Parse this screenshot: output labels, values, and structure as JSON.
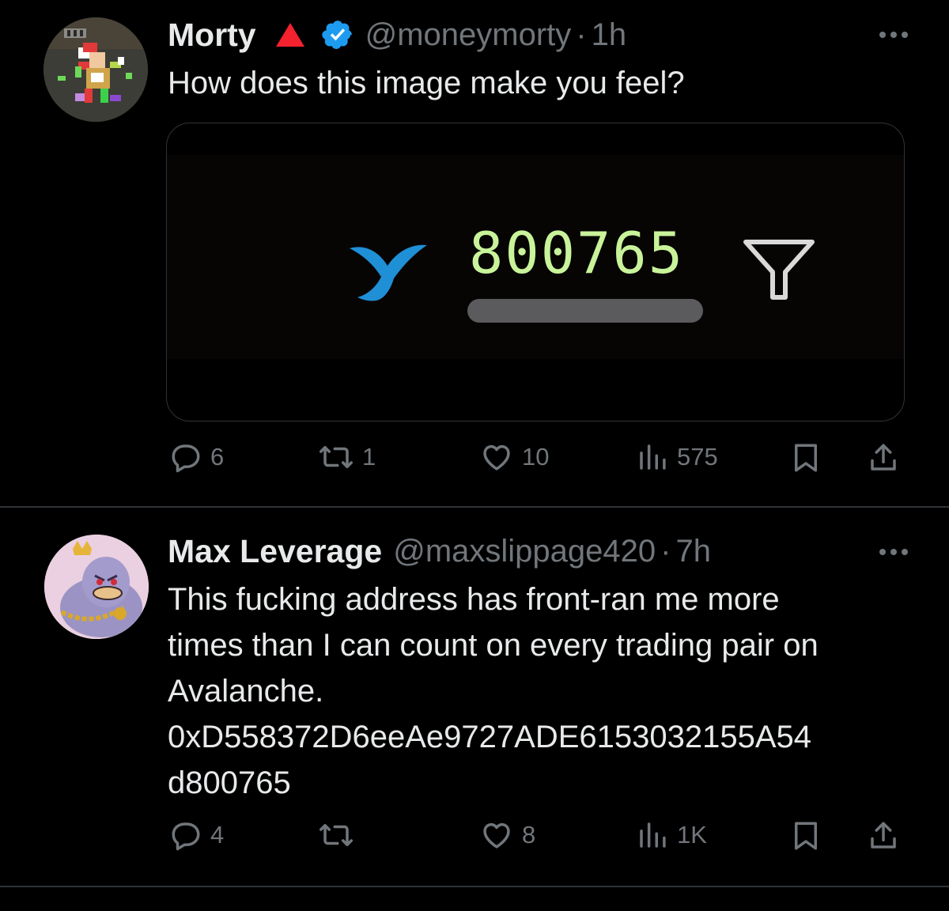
{
  "tweets": [
    {
      "display_name": "Morty",
      "handle": "@moneymorty",
      "separator": "·",
      "time": "1h",
      "text": "How does this image make you feel?",
      "media": {
        "counter": "800765"
      },
      "stats": {
        "replies": "6",
        "reposts": "1",
        "likes": "10",
        "views": "575"
      }
    },
    {
      "display_name": "Max Leverage",
      "handle": "@maxslippage420",
      "separator": "·",
      "time": "7h",
      "text_lines": [
        "This fucking address has front-ran me more",
        "times than I can count on every trading pair on",
        "Avalanche.",
        "0xD558372D6eeAe9727ADE6153032155A54",
        "d800765"
      ],
      "stats": {
        "replies": "4",
        "reposts": "",
        "likes": "8",
        "views": "1K"
      }
    }
  ],
  "colors": {
    "background": "#000000",
    "text": "#e7e9ea",
    "muted": "#71767b",
    "verified": "#1d9bf0",
    "counter": "#c9f39a",
    "whale": "#1f8fd6",
    "red_badge": "#f4212e"
  },
  "icons": [
    "red-triangle-icon",
    "verified-badge-icon",
    "more-icon",
    "reply-icon",
    "repost-icon",
    "like-icon",
    "views-icon",
    "bookmark-icon",
    "share-icon",
    "whale-tail-icon",
    "filter-funnel-icon"
  ]
}
